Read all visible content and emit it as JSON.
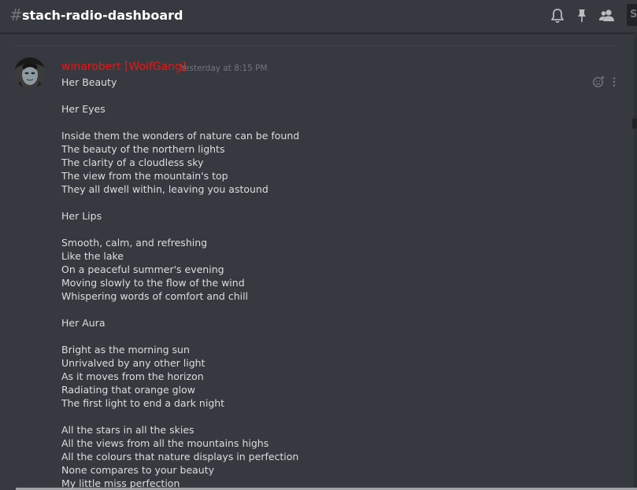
{
  "header": {
    "hash_symbol": "#",
    "channel_name": "stach-radio-dashboard",
    "search_stub": "S",
    "icons": [
      "bell-icon",
      "pin-icon",
      "members-icon"
    ]
  },
  "message": {
    "username": "winarobert [WolfGang]",
    "username_color": "#f01313",
    "timestamp": "Yesterday at 8:15 PM",
    "lines": [
      "Her Beauty",
      "",
      "Her Eyes",
      "",
      "Inside them the wonders of nature can be found",
      "The beauty of the northern lights",
      "The clarity of a cloudless sky",
      "The view from the mountain's top",
      "They all dwell within, leaving you astound",
      "",
      "Her Lips",
      "",
      "Smooth, calm, and refreshing",
      "Like the lake",
      "On a peaceful summer's evening",
      "Moving slowly to the flow of the wind",
      "Whispering words of comfort and chill",
      "",
      "Her Aura",
      "",
      "Bright as the morning sun",
      "Unrivalved by any other light",
      "As it moves from the horizon",
      "Radiating that orange glow",
      "The first light to end a dark night",
      "",
      "All the stars in all the skies",
      "All the views from all the mountains highs",
      "All the colours that nature displays in perfection",
      "None compares to your beauty",
      "My little miss perfection"
    ]
  }
}
